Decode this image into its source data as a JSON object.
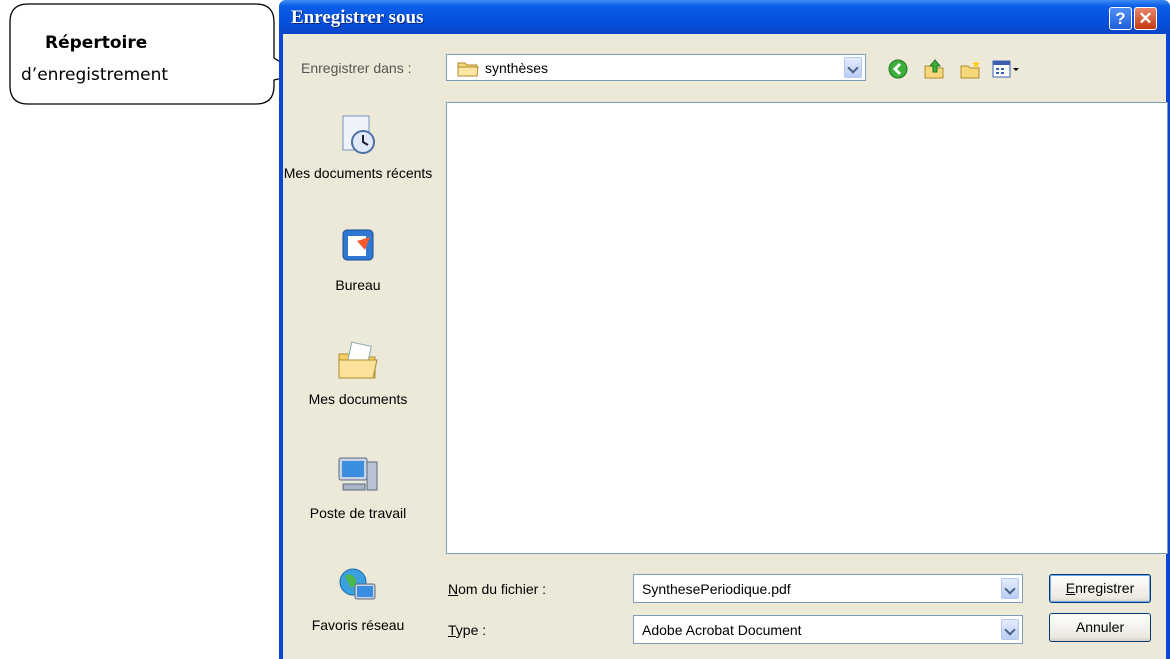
{
  "callout": {
    "title": "Répertoire",
    "subtitle": "d’enregistrement"
  },
  "window": {
    "title": "Enregistrer sous",
    "help_icon": "help-icon",
    "close_icon": "close-icon"
  },
  "lookin": {
    "label": "Enregistrer dans :",
    "value": "synthèses"
  },
  "toolbar": {
    "icons": [
      "back-icon",
      "up-folder-icon",
      "new-folder-icon",
      "views-menu-icon"
    ]
  },
  "places": [
    {
      "label": "Mes documents récents",
      "icon": "recent-documents-icon"
    },
    {
      "label": "Bureau",
      "icon": "desktop-icon"
    },
    {
      "label": "Mes documents",
      "icon": "my-documents-icon"
    },
    {
      "label": "Poste de travail",
      "icon": "my-computer-icon"
    },
    {
      "label": "Favoris réseau",
      "icon": "network-places-icon"
    }
  ],
  "filename": {
    "label_first": "N",
    "label_rest": "om du fichier :",
    "value": "SynthesePeriodique.pdf"
  },
  "filetype": {
    "label_first": "T",
    "label_rest": "ype :",
    "value": "Adobe Acrobat Document"
  },
  "buttons": {
    "save_first": "E",
    "save_rest": "nregistrer",
    "cancel": "Annuler"
  },
  "colors": {
    "titlebar": "#0a46d8",
    "dialog_bg": "#ece9d8",
    "close_button": "#c53a10"
  }
}
